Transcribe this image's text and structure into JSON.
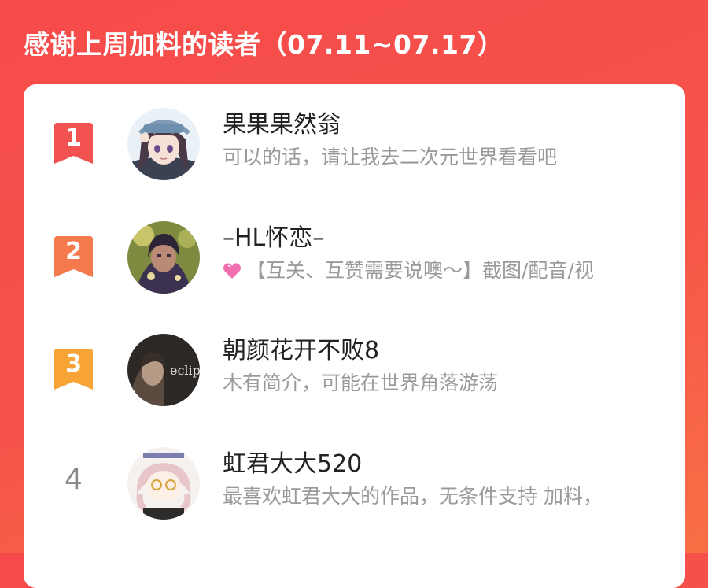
{
  "header": {
    "title": "感谢上周加料的读者（07.11~07.17）"
  },
  "colors": {
    "rank1": "#f25252",
    "rank2": "#f47a4d",
    "rank3": "#f7a336",
    "rank_plain": "#8a8a8a"
  },
  "readers": [
    {
      "rank": "1",
      "name": "果果果然翁",
      "bio": "可以的话，请让我去二次元世界看看吧",
      "avatar_icon": "anime-girl-avatar"
    },
    {
      "rank": "2",
      "name": "–HL怀恋–",
      "bio_icon": "pink-heart-emoji",
      "bio": "【互关、互赞需要说噢～】截图/配音/视",
      "avatar_icon": "anime-character-avatar"
    },
    {
      "rank": "3",
      "name": "朝颜花开不败8",
      "bio": "木有简介，可能在世界角落游荡",
      "avatar_icon": "eclipse-movie-poster-avatar",
      "avatar_text": "eclipse"
    },
    {
      "rank": "4",
      "name": "虹君大大520",
      "bio": "最喜欢虹君大大的作品，无条件支持 加料，",
      "avatar_icon": "chibi-drawing-avatar"
    }
  ]
}
